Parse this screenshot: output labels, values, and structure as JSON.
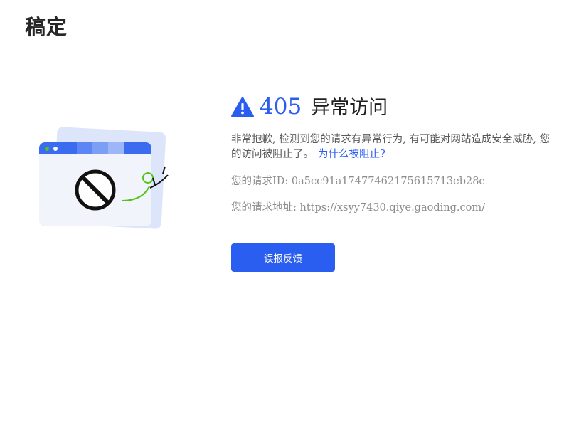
{
  "brand": {
    "logo_text": "稿定"
  },
  "error": {
    "code": "405",
    "title": "异常访问",
    "description": "非常抱歉, 检测到您的请求有异常行为, 有可能对网站造成安全威胁, 您的访问被阻止了。",
    "why_link": "为什么被阻止?",
    "request_id_label": "您的请求ID: ",
    "request_id": "0a5cc91a17477462175615713eb28e",
    "request_url_label": "您的请求地址: ",
    "request_url": "https://xsyy7430.qiye.gaoding.com/"
  },
  "actions": {
    "feedback_label": "误报反馈"
  },
  "colors": {
    "accent": "#2a5ef0",
    "green": "#52c41a",
    "browser_bar": "#3b6cf0",
    "window_back": "#dde5fb",
    "window_front": "#f1f4fb"
  },
  "icons": {
    "title": "warning-triangle-icon",
    "illustration": "blocked-browser-window-illustration"
  }
}
